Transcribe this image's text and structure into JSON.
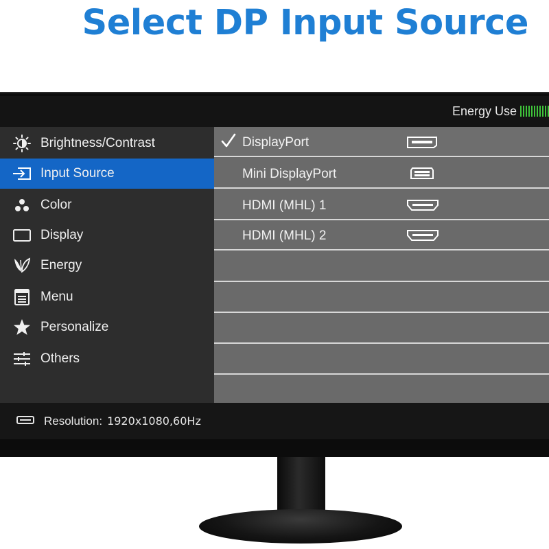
{
  "headline": "Select DP Input Source",
  "topbar": {
    "energy_label": "Energy Use",
    "energy_color": "#3fc33a"
  },
  "sidebar": {
    "items": [
      {
        "label": "Brightness/Contrast",
        "icon": "brightness-icon",
        "active": false
      },
      {
        "label": "Input Source",
        "icon": "input-source-icon",
        "active": true
      },
      {
        "label": "Color",
        "icon": "color-dots-icon",
        "active": false
      },
      {
        "label": "Display",
        "icon": "display-icon",
        "active": false
      },
      {
        "label": "Energy",
        "icon": "leaf-icon",
        "active": false
      },
      {
        "label": "Menu",
        "icon": "menu-icon",
        "active": false
      },
      {
        "label": "Personalize",
        "icon": "star-icon",
        "active": false
      },
      {
        "label": "Others",
        "icon": "sliders-icon",
        "active": false
      }
    ],
    "active_color": "#1466c6"
  },
  "inputs": {
    "rows": [
      {
        "label": "DisplayPort",
        "icon": "displayport-icon",
        "selected": true
      },
      {
        "label": "Mini DisplayPort",
        "icon": "mini-displayport-icon",
        "selected": false
      },
      {
        "label": "HDMI (MHL) 1",
        "icon": "hdmi-icon",
        "selected": false
      },
      {
        "label": "HDMI (MHL) 2",
        "icon": "hdmi-icon",
        "selected": false
      }
    ]
  },
  "status": {
    "label": "Resolution:",
    "value": "1920x1080,60Hz",
    "icon": "port-icon"
  },
  "colors": {
    "headline": "#1f7fd4",
    "sidebar_bg": "#2d2d2d",
    "content_bg": "#6a6a6a"
  }
}
